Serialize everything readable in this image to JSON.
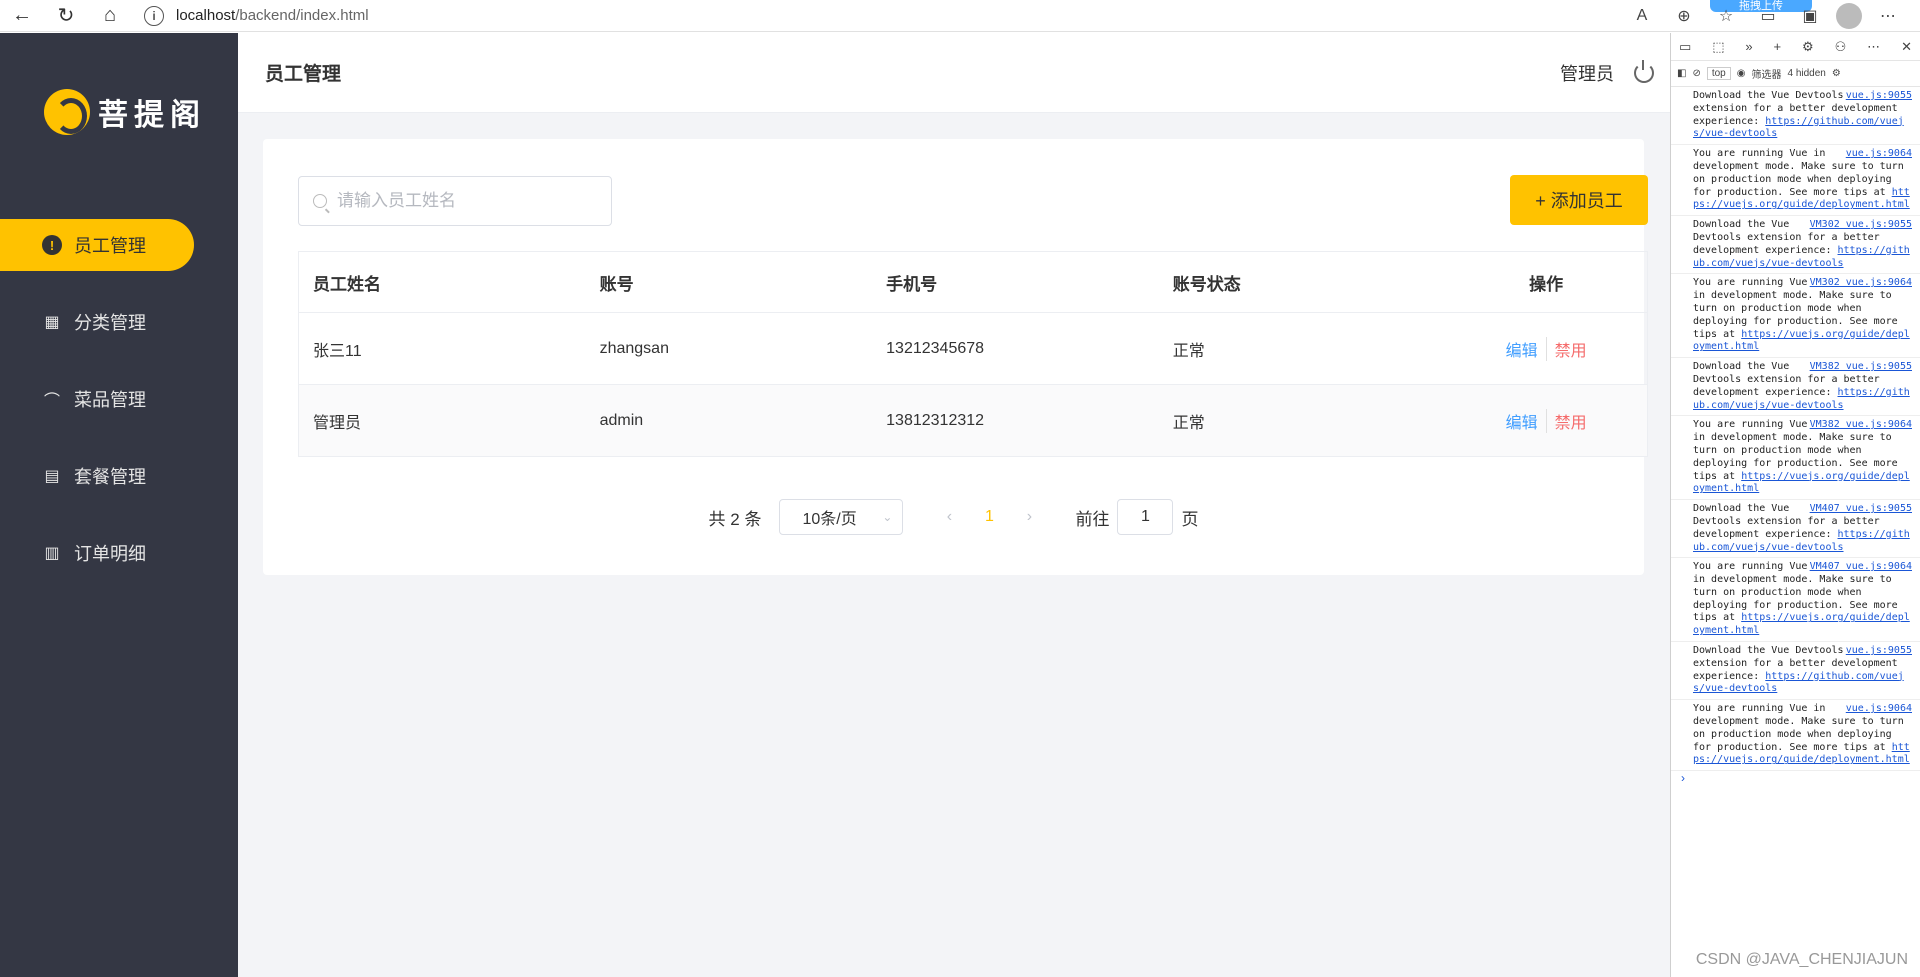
{
  "browser": {
    "url_host": "localhost",
    "url_path": "/backend/index.html",
    "upload_label": "拖拽上传"
  },
  "app": {
    "logo_text": "菩提阁",
    "header": {
      "title": "员工管理",
      "user": "管理员"
    },
    "menu": [
      {
        "label": "员工管理",
        "icon": "info-icon",
        "active": true
      },
      {
        "label": "分类管理",
        "icon": "grid-icon"
      },
      {
        "label": "菜品管理",
        "icon": "dish-cover-icon"
      },
      {
        "label": "套餐管理",
        "icon": "gift-icon"
      },
      {
        "label": "订单明细",
        "icon": "clipboard-icon"
      }
    ]
  },
  "toolbar": {
    "search_placeholder": "请输入员工姓名",
    "add_label": "+ 添加员工"
  },
  "table": {
    "headers": [
      "员工姓名",
      "账号",
      "手机号",
      "账号状态",
      "操作"
    ],
    "rows": [
      {
        "name": "张三11",
        "account": "zhangsan",
        "phone": "13212345678",
        "status": "正常",
        "edit": "编辑",
        "ban": "禁用"
      },
      {
        "name": "管理员",
        "account": "admin",
        "phone": "13812312312",
        "status": "正常",
        "edit": "编辑",
        "ban": "禁用"
      }
    ]
  },
  "pagination": {
    "total": "共 2 条",
    "page_size": "10条/页",
    "current": "1",
    "goto_prefix": "前往",
    "goto_value": "1",
    "goto_suffix": "页"
  },
  "devtools": {
    "context": "top",
    "filter": "筛选器",
    "hidden": "4 hidden",
    "logs": [
      {
        "text": "Download the Vue Devtools extension for a better development experience:",
        "src": "vue.js:9055",
        "link": "https://github.com/vuejs/vue-devtools"
      },
      {
        "text": "You are running Vue in development mode. Make sure to turn on production mode when deploying for production. See more tips at",
        "src": "vue.js:9064",
        "link": "https://vuejs.org/guide/deployment.html"
      },
      {
        "text": "Download the Vue Devtools extension for a better development experience:",
        "src": "VM302 vue.js:9055",
        "link": "https://github.com/vuejs/vue-devtools"
      },
      {
        "text": "You are running Vue in development mode. Make sure to turn on production mode when deploying for production. See more tips at",
        "src": "VM302 vue.js:9064",
        "link": "https://vuejs.org/guide/deployment.html"
      },
      {
        "text": "Download the Vue Devtools extension for a better development experience:",
        "src": "VM382 vue.js:9055",
        "link": "https://github.com/vuejs/vue-devtools"
      },
      {
        "text": "You are running Vue in development mode. Make sure to turn on production mode when deploying for production. See more tips at",
        "src": "VM382 vue.js:9064",
        "link": "https://vuejs.org/guide/deployment.html"
      },
      {
        "text": "Download the Vue Devtools extension for a better development experience:",
        "src": "VM407 vue.js:9055",
        "link": "https://github.com/vuejs/vue-devtools"
      },
      {
        "text": "You are running Vue in development mode. Make sure to turn on production mode when deploying for production. See more tips at",
        "src": "VM407 vue.js:9064",
        "link": "https://vuejs.org/guide/deployment.html"
      },
      {
        "text": "Download the Vue Devtools extension for a better development experience:",
        "src": "vue.js:9055",
        "link": "https://github.com/vuejs/vue-devtools"
      },
      {
        "text": "You are running Vue in development mode. Make sure to turn on production mode when deploying for production. See more tips at",
        "src": "vue.js:9064",
        "link": "https://vuejs.org/guide/deployment.html"
      }
    ]
  },
  "watermark": "CSDN @JAVA_CHENJIAJUN",
  "colors": {
    "accent": "#ffc200",
    "sidebar": "#343744",
    "edit": "#419eff",
    "ban": "#f56c6c"
  }
}
